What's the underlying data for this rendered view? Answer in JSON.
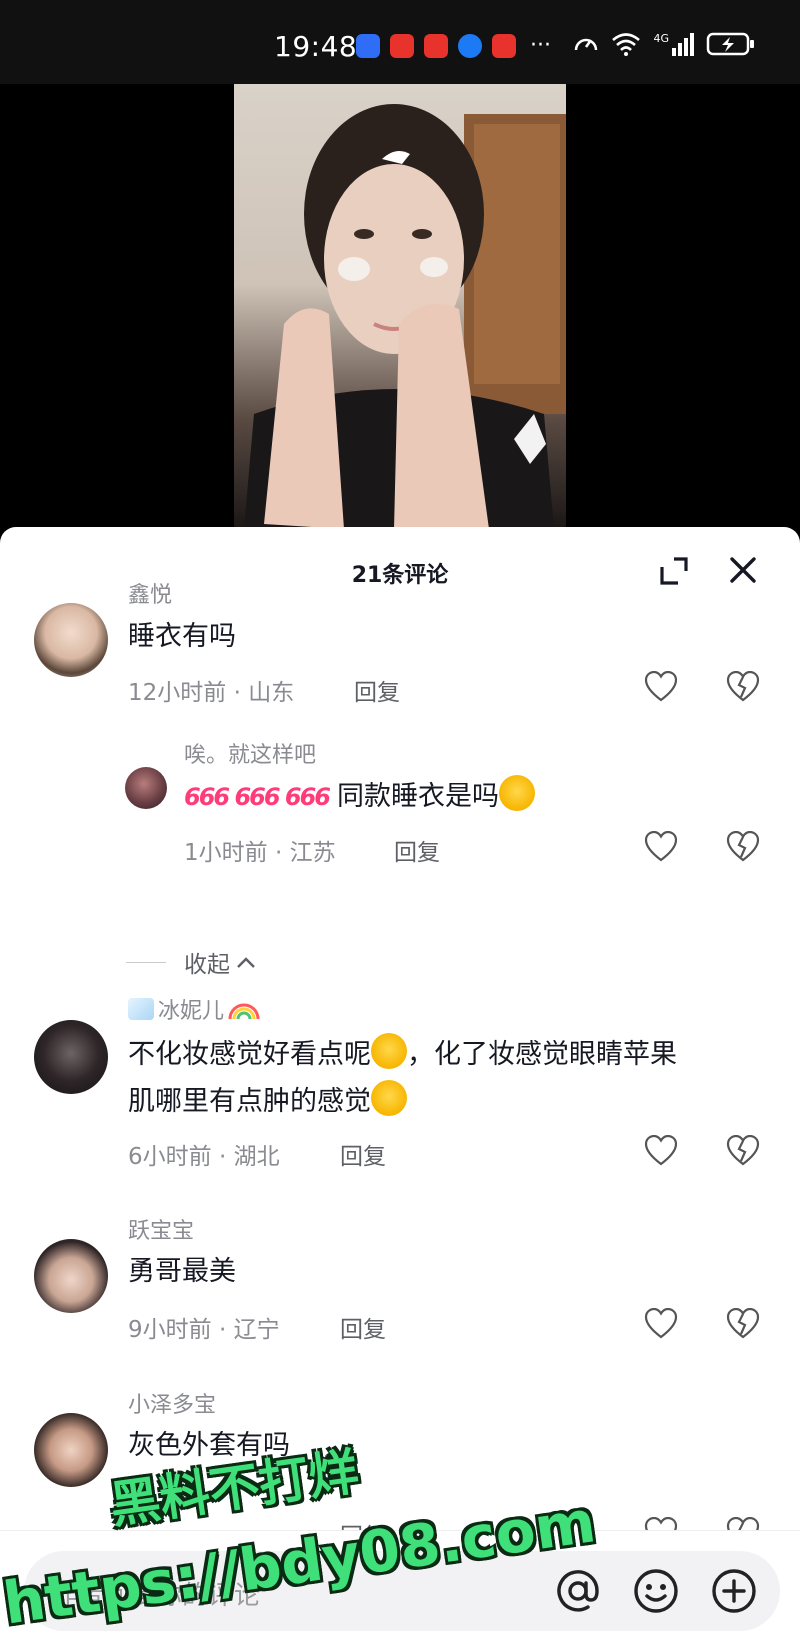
{
  "status": {
    "time": "19:48",
    "dots": "···",
    "network": "4G"
  },
  "sheet": {
    "title": "21条评论",
    "collapse_label": "收起"
  },
  "comments": [
    {
      "name": "鑫悦",
      "text": "睡衣有吗",
      "meta": "12小时前 · 山东",
      "reply": "回复",
      "replies": [
        {
          "name": "唉。就这样吧",
          "prefix": "666 666 666",
          "text": "同款睡衣是吗",
          "meta": "1小时前 · 江苏",
          "reply": "回复"
        }
      ]
    },
    {
      "name": "冰妮儿",
      "text_line1": "不化妆感觉好看点呢",
      "text_line1b": "，化了妆感觉眼睛苹果",
      "text_line2": "肌哪里有点肿的感觉",
      "meta": "6小时前 · 湖北",
      "reply": "回复"
    },
    {
      "name": "跃宝宝",
      "text": "勇哥最美",
      "meta": "9小时前 · 辽宁",
      "reply": "回复"
    },
    {
      "name": "小泽多宝",
      "text": "灰色外套有吗",
      "reply": "回复"
    }
  ],
  "input": {
    "placeholder": "作者回复你的评论"
  },
  "watermark": {
    "line1": "黑料不打烊",
    "line2": "https://bdy08.com"
  },
  "colors": {
    "accent_green": "#3fe07a",
    "text_primary": "#161823",
    "text_secondary": "#8a8b91"
  }
}
